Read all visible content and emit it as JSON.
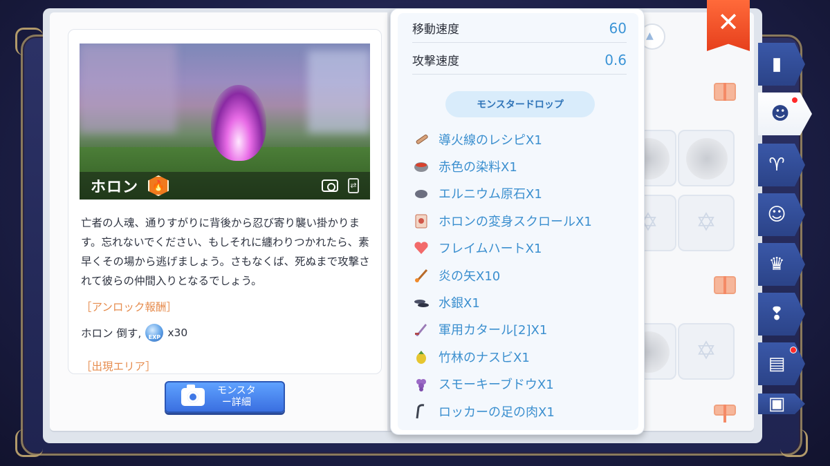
{
  "monster": {
    "name": "ホロン",
    "element_icon": "fire-icon",
    "description": "亡者の人魂、通りすがりに背後から忍び寄り襲い掛かります。忘れないでください、もしそれに纏わりつかれたら、素早くその場から逃げましょう。さもなくば、死ぬまで攻撃されて彼らの仲間入りとなるでしょう。"
  },
  "unlock": {
    "heading": "［アンロック報酬］",
    "condition": "ホロン 倒す,",
    "reward_icon": "exp-icon",
    "exp_badge": "EXP",
    "amount": "x30"
  },
  "area": {
    "heading": "［出現エリア］"
  },
  "detail_button": {
    "label": "モンスタ\nー詳細"
  },
  "stats": [
    {
      "label": "移動速度",
      "value": "60"
    },
    {
      "label": "攻撃速度",
      "value": "0.6"
    }
  ],
  "drops": {
    "heading": "モンスタードロップ",
    "items": [
      {
        "name": "導火線のレシピX1",
        "icon": "scroll-recipe-icon"
      },
      {
        "name": "赤色の染料X1",
        "icon": "dye-bowl-icon"
      },
      {
        "name": "エルニウム原石X1",
        "icon": "ore-icon"
      },
      {
        "name": "ホロンの変身スクロールX1",
        "icon": "transform-scroll-icon"
      },
      {
        "name": "フレイムハートX1",
        "icon": "heart-gem-icon"
      },
      {
        "name": "炎の矢X10",
        "icon": "fire-arrow-icon"
      },
      {
        "name": "水銀X1",
        "icon": "mercury-icon"
      },
      {
        "name": "軍用カタール[2]X1",
        "icon": "katar-icon"
      },
      {
        "name": "竹林のナスビX1",
        "icon": "eggplant-icon"
      },
      {
        "name": "スモーキーブドウX1",
        "icon": "grape-icon"
      },
      {
        "name": "ロッカーの足の肉X1",
        "icon": "meat-leg-icon"
      }
    ]
  },
  "close_icon": "close-icon",
  "side_tabs": [
    {
      "icon": "book-icon",
      "active": false,
      "notify": false
    },
    {
      "icon": "cat-face-icon",
      "active": true,
      "notify": true
    },
    {
      "icon": "horns-icon",
      "active": false,
      "notify": false
    },
    {
      "icon": "pet-icon",
      "active": false,
      "notify": false
    },
    {
      "icon": "chef-hat-icon",
      "active": false,
      "notify": false
    },
    {
      "icon": "quest-head-icon",
      "active": false,
      "notify": false
    },
    {
      "icon": "map-book-icon",
      "active": false,
      "notify": true
    },
    {
      "icon": "card-icon",
      "active": false,
      "notify": false
    }
  ],
  "colors": {
    "accent": "#3b94d6",
    "heading_orange": "#e68c4e",
    "close_red": "#e63f1c",
    "tab_blue": "#2b4388"
  }
}
